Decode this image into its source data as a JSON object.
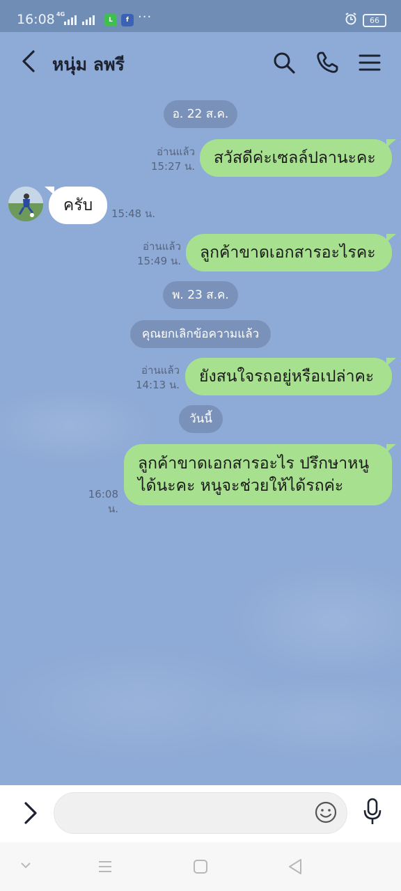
{
  "status_bar": {
    "time": "16:08",
    "network": "4G",
    "battery": "66",
    "icons": [
      "signal-icon",
      "line-app-icon",
      "facebook-icon",
      "more-icon",
      "alarm-icon",
      "battery-icon"
    ]
  },
  "header": {
    "title": "หนุ่ม ลพรี",
    "back_icon": "back-arrow-icon",
    "actions": [
      "search-icon",
      "phone-icon",
      "menu-icon"
    ]
  },
  "chat": {
    "date_1": "อ. 22 ส.ค.",
    "msg_1": {
      "text": "สวัสดีค่ะเซลล์ปลานะคะ",
      "read": "อ่านแล้ว",
      "time": "15:27 น."
    },
    "msg_2": {
      "text": "ครับ",
      "time": "15:48 น."
    },
    "msg_3": {
      "text": "ลูกค้าขาดเอกสารอะไรคะ",
      "read": "อ่านแล้ว",
      "time": "15:49 น."
    },
    "date_2": "พ. 23 ส.ค.",
    "unsent_notice": "คุณยกเลิกข้อความแล้ว",
    "msg_4": {
      "text": "ยังสนใจรถอยู่หรือเปล่าคะ",
      "read": "อ่านแล้ว",
      "time": "14:13 น."
    },
    "date_3": "วันนี้",
    "msg_5": {
      "line1": "ลูกค้าขาดเอกสารอะไร ปรึกษาหนู",
      "line2": "ได้นะคะ หนูจะช่วยให้ได้รถค่ะ",
      "time": "16:08 น."
    }
  },
  "input": {
    "value": "",
    "placeholder": ""
  },
  "colors": {
    "chat_background": "#8eaad6",
    "my_bubble": "#a7e08e",
    "their_bubble": "#ffffff",
    "status_bar": "#6f8db5",
    "date_pill": "#7a92ba"
  }
}
